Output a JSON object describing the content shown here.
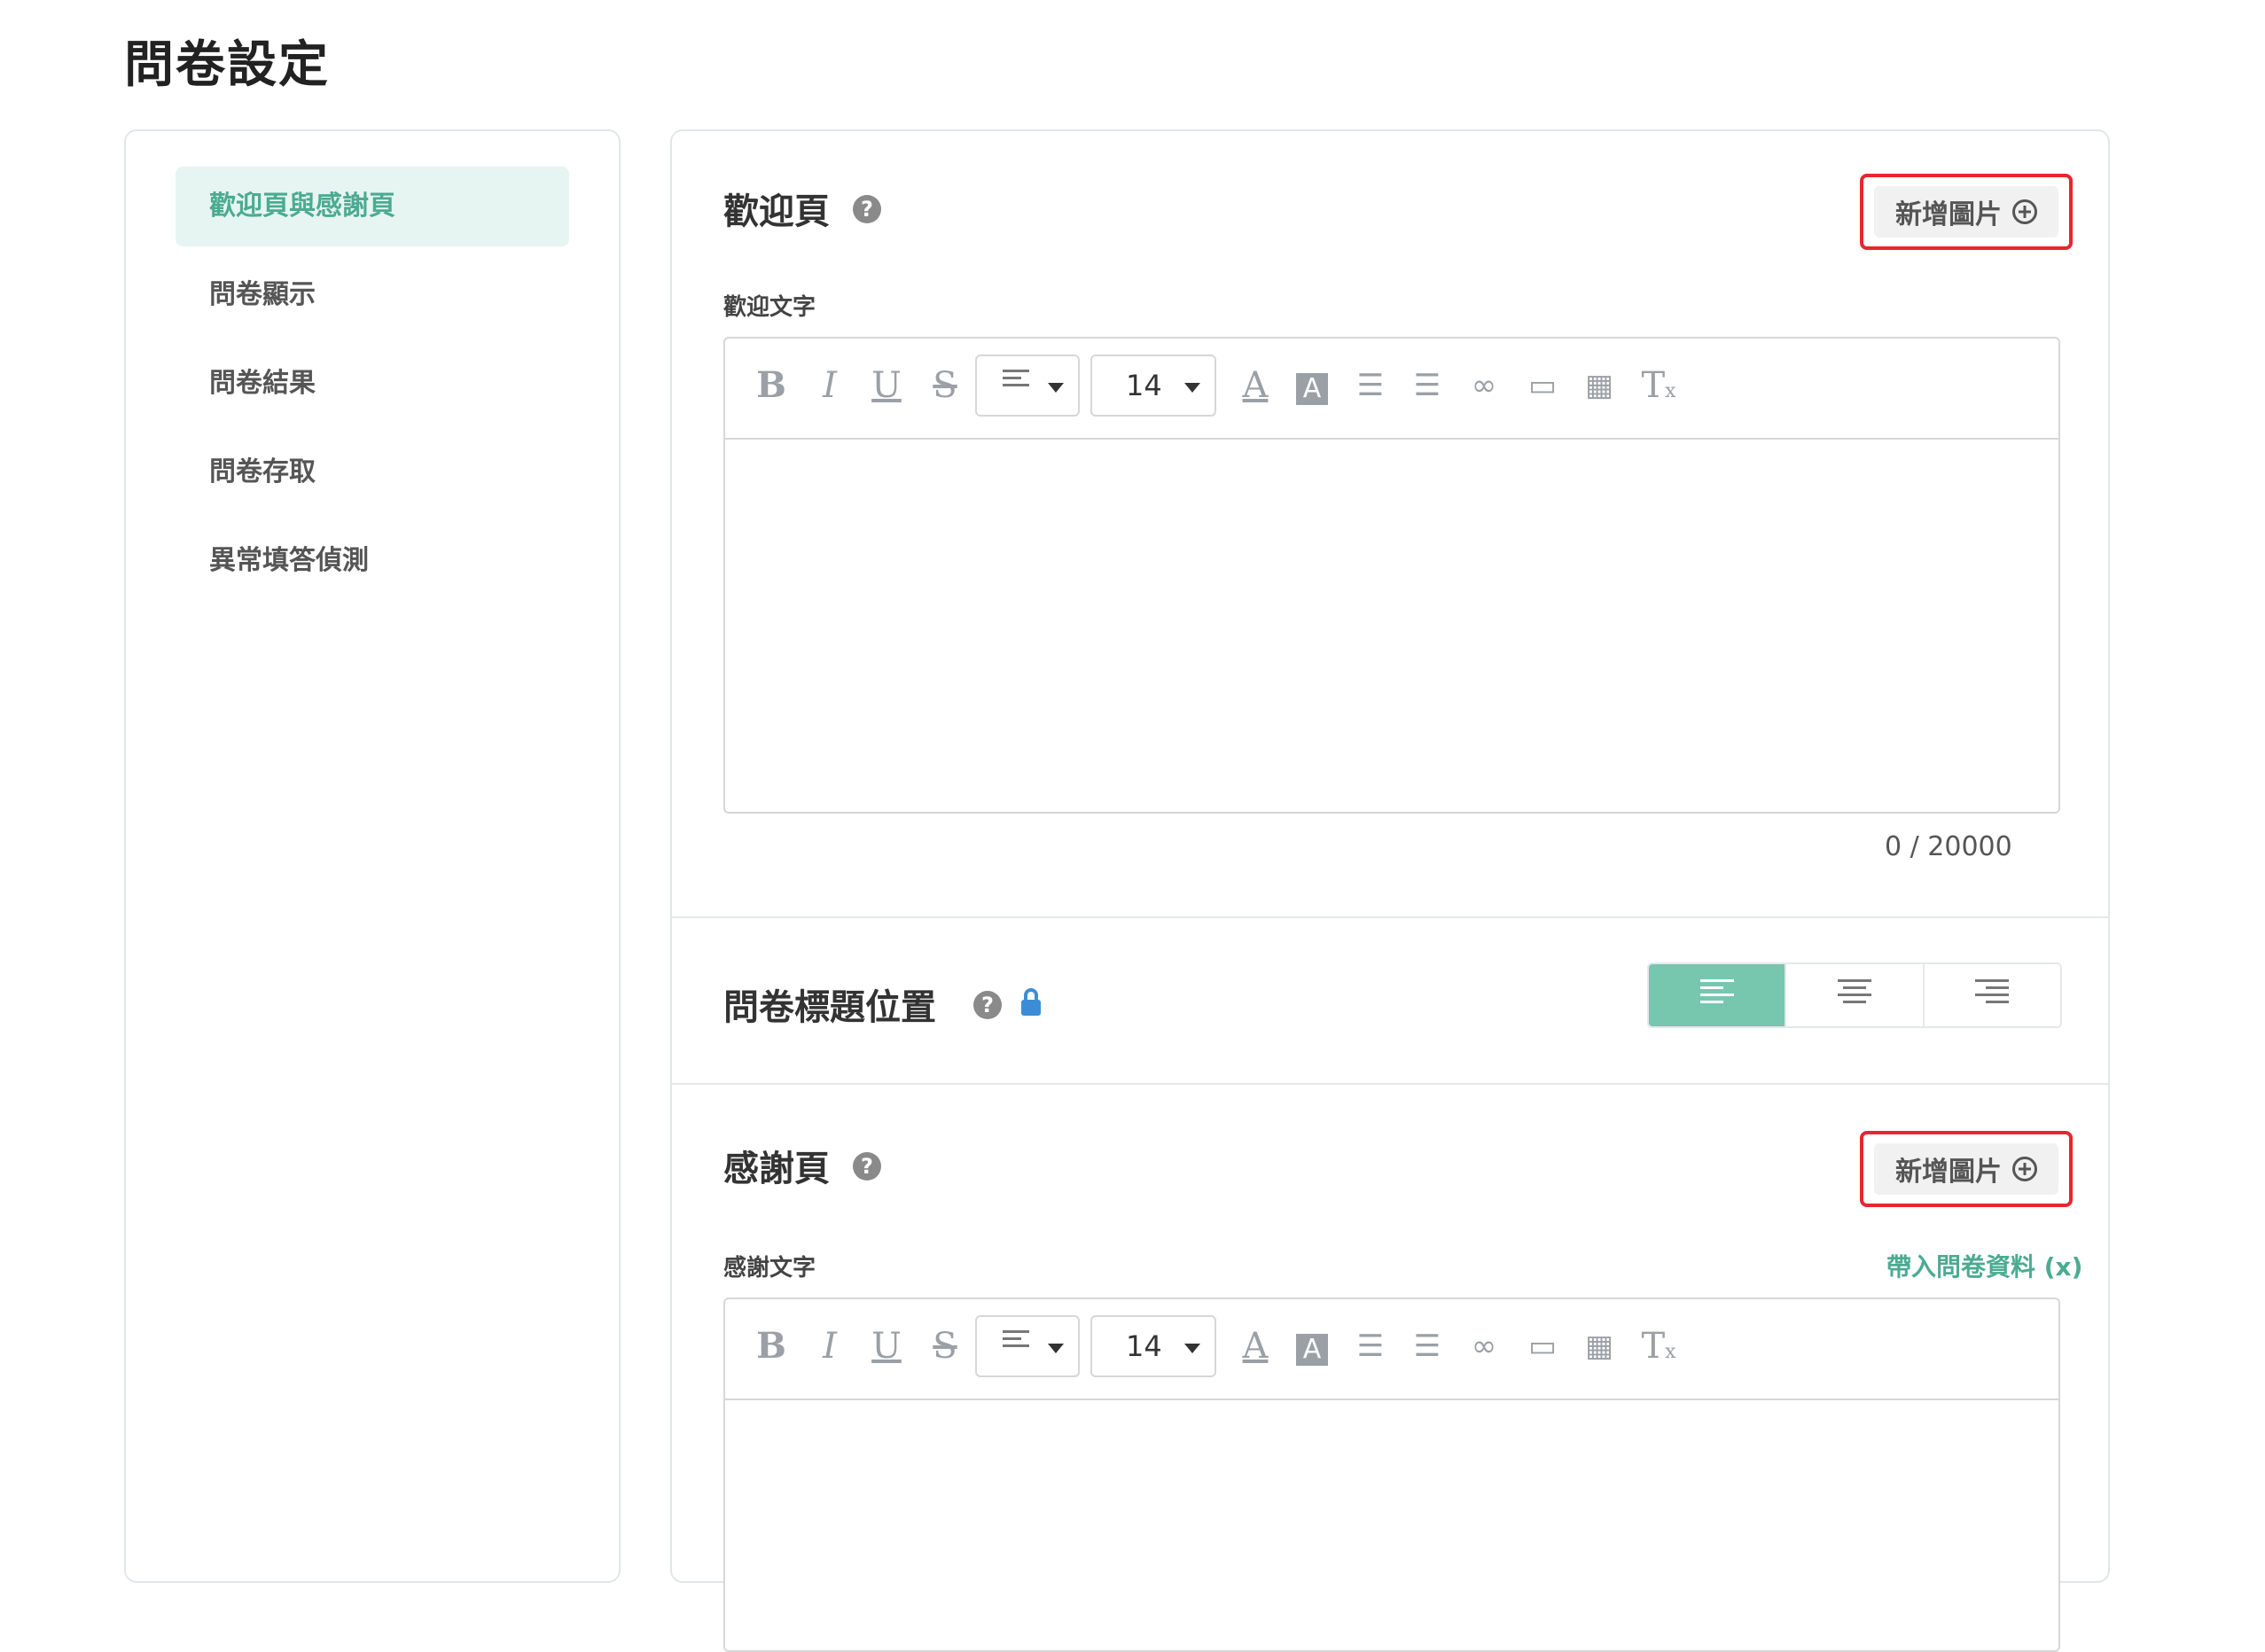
{
  "page": {
    "title": "問卷設定"
  },
  "sidebar": {
    "items": [
      {
        "label": "歡迎頁與感謝頁",
        "active": true
      },
      {
        "label": "問卷顯示",
        "active": false
      },
      {
        "label": "問卷結果",
        "active": false
      },
      {
        "label": "問卷存取",
        "active": false
      },
      {
        "label": "異常填答偵測",
        "active": false
      }
    ]
  },
  "welcome": {
    "title": "歡迎頁",
    "add_image_label": "新增圖片",
    "field_label": "歡迎文字",
    "counter": "0 / 20000",
    "toolbar": {
      "font_size": "14"
    }
  },
  "title_position": {
    "title": "問卷標題位置",
    "options": [
      "left",
      "center",
      "right"
    ],
    "selected": "left"
  },
  "thanks": {
    "title": "感謝頁",
    "add_image_label": "新增圖片",
    "field_label": "感謝文字",
    "insert_link": "帶入問卷資料 (x)",
    "toolbar": {
      "font_size": "14"
    }
  },
  "colors": {
    "accent": "#4bab92",
    "accent_light": "#e6f5f1",
    "highlight_border": "#e8262c"
  }
}
